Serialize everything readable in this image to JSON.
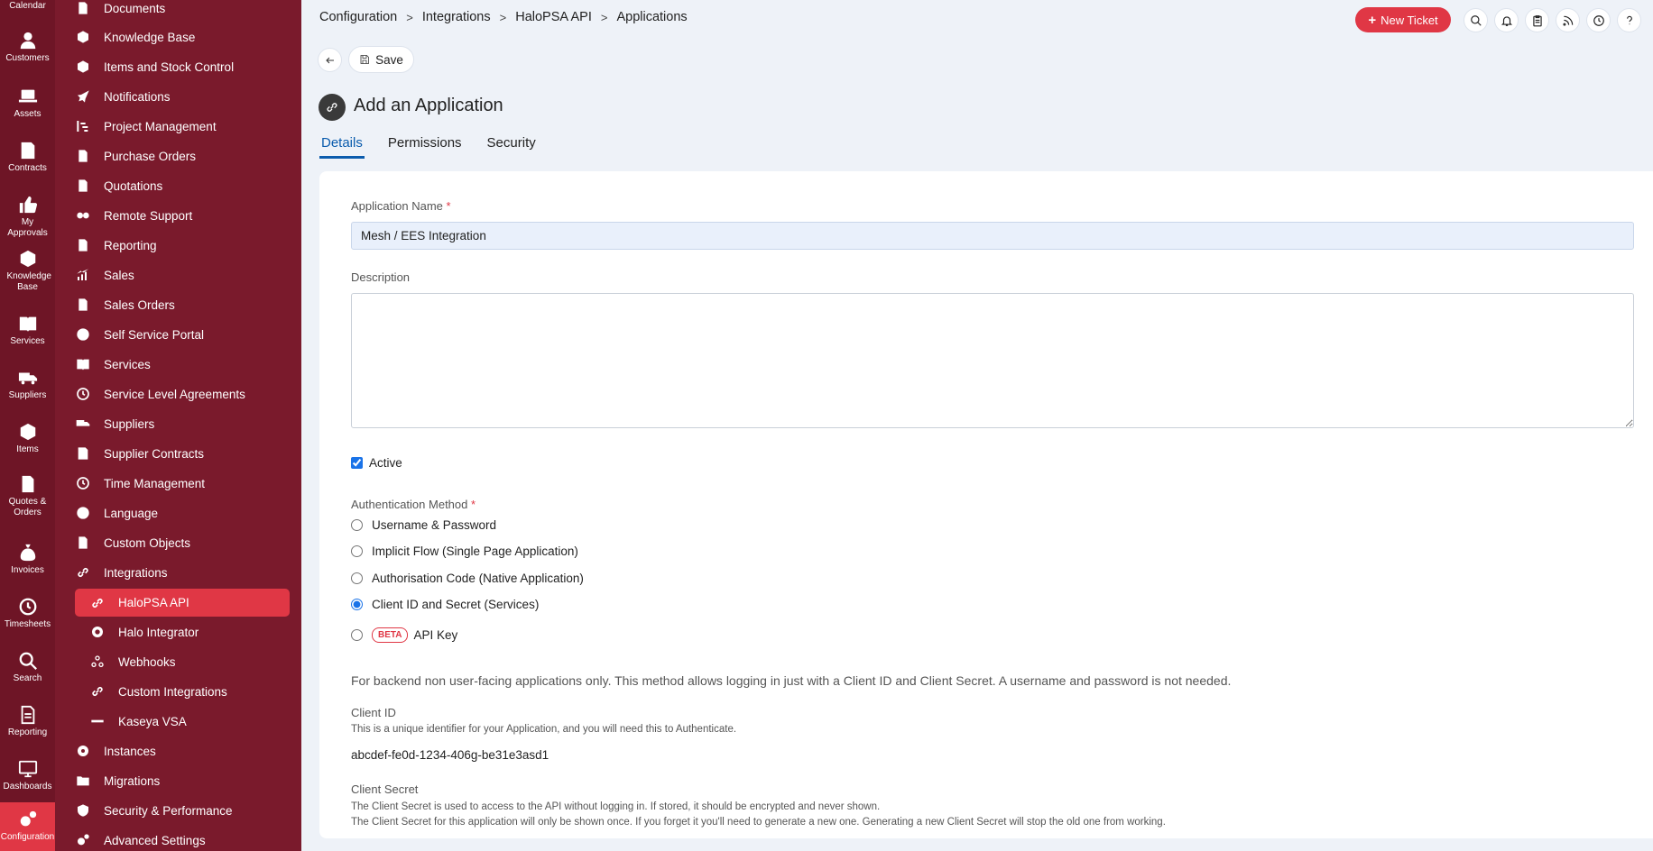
{
  "rail": [
    {
      "label": "Calendar",
      "icon": "calendar-icon"
    },
    {
      "label": "Customers",
      "icon": "user-icon"
    },
    {
      "label": "Assets",
      "icon": "laptop-icon"
    },
    {
      "label": "Contracts",
      "icon": "contract-icon"
    },
    {
      "label": "My Approvals",
      "icon": "thumbs-up-icon"
    },
    {
      "label": "Knowledge Base",
      "icon": "book-icon"
    },
    {
      "label": "Services",
      "icon": "book-open-icon"
    },
    {
      "label": "Suppliers",
      "icon": "truck-icon"
    },
    {
      "label": "Items",
      "icon": "box-icon"
    },
    {
      "label": "Quotes & Orders",
      "icon": "document-search-icon"
    },
    {
      "label": "Invoices",
      "icon": "money-bag-icon"
    },
    {
      "label": "Timesheets",
      "icon": "clock-icon"
    },
    {
      "label": "Search",
      "icon": "search-icon"
    },
    {
      "label": "Reporting",
      "icon": "report-icon"
    },
    {
      "label": "Dashboards",
      "icon": "monitor-icon"
    },
    {
      "label": "Configuration",
      "icon": "gears-icon"
    }
  ],
  "menu": [
    {
      "label": "Documents"
    },
    {
      "label": "Knowledge Base"
    },
    {
      "label": "Items and Stock Control"
    },
    {
      "label": "Notifications"
    },
    {
      "label": "Project Management"
    },
    {
      "label": "Purchase Orders"
    },
    {
      "label": "Quotations"
    },
    {
      "label": "Remote Support"
    },
    {
      "label": "Reporting"
    },
    {
      "label": "Sales"
    },
    {
      "label": "Sales Orders"
    },
    {
      "label": "Self Service Portal"
    },
    {
      "label": "Services"
    },
    {
      "label": "Service Level Agreements"
    },
    {
      "label": "Suppliers"
    },
    {
      "label": "Supplier Contracts"
    },
    {
      "label": "Time Management"
    },
    {
      "label": "Language"
    },
    {
      "label": "Custom Objects"
    },
    {
      "label": "Integrations"
    },
    {
      "label": "HaloPSA API"
    },
    {
      "label": "Halo Integrator"
    },
    {
      "label": "Webhooks"
    },
    {
      "label": "Custom Integrations"
    },
    {
      "label": "Kaseya VSA"
    },
    {
      "label": "Instances"
    },
    {
      "label": "Migrations"
    },
    {
      "label": "Security & Performance"
    },
    {
      "label": "Advanced Settings"
    }
  ],
  "breadcrumb": [
    "Configuration",
    "Integrations",
    "HaloPSA API",
    "Applications"
  ],
  "header": {
    "new_ticket": "New Ticket"
  },
  "toolbar": {
    "save": "Save"
  },
  "page": {
    "title": "Add an Application"
  },
  "tabs": [
    "Details",
    "Permissions",
    "Security"
  ],
  "form": {
    "app_name_label": "Application Name",
    "app_name_value": "Mesh / EES Integration",
    "description_label": "Description",
    "active_label": "Active",
    "auth_label": "Authentication Method",
    "auth_options": [
      "Username & Password",
      "Implicit Flow (Single Page Application)",
      "Authorisation Code (Native Application)",
      "Client ID and Secret (Services)",
      "API Key"
    ],
    "beta": "BETA",
    "auth_note": "For backend non user-facing applications only. This method allows logging in just with a Client ID and Client Secret. A username and password is not needed.",
    "client_id_label": "Client ID",
    "client_id_help": "This is a unique identifier for your Application, and you will need this to Authenticate.",
    "client_id_value": "abcdef-fe0d-1234-406g-be31e3asd1",
    "client_secret_label": "Client Secret",
    "client_secret_help1": "The Client Secret is used to access to the API without logging in. If stored, it should be encrypted and never shown.",
    "client_secret_help2": "The Client Secret for this application will only be shown once. If you forget it you'll need to generate a new one. Generating a new Client Secret will stop the old one from working."
  },
  "colors": {
    "rail": "#6e1526",
    "menu": "#7a1a2c",
    "accent": "#e03745",
    "tab_active": "#0b5cad"
  }
}
